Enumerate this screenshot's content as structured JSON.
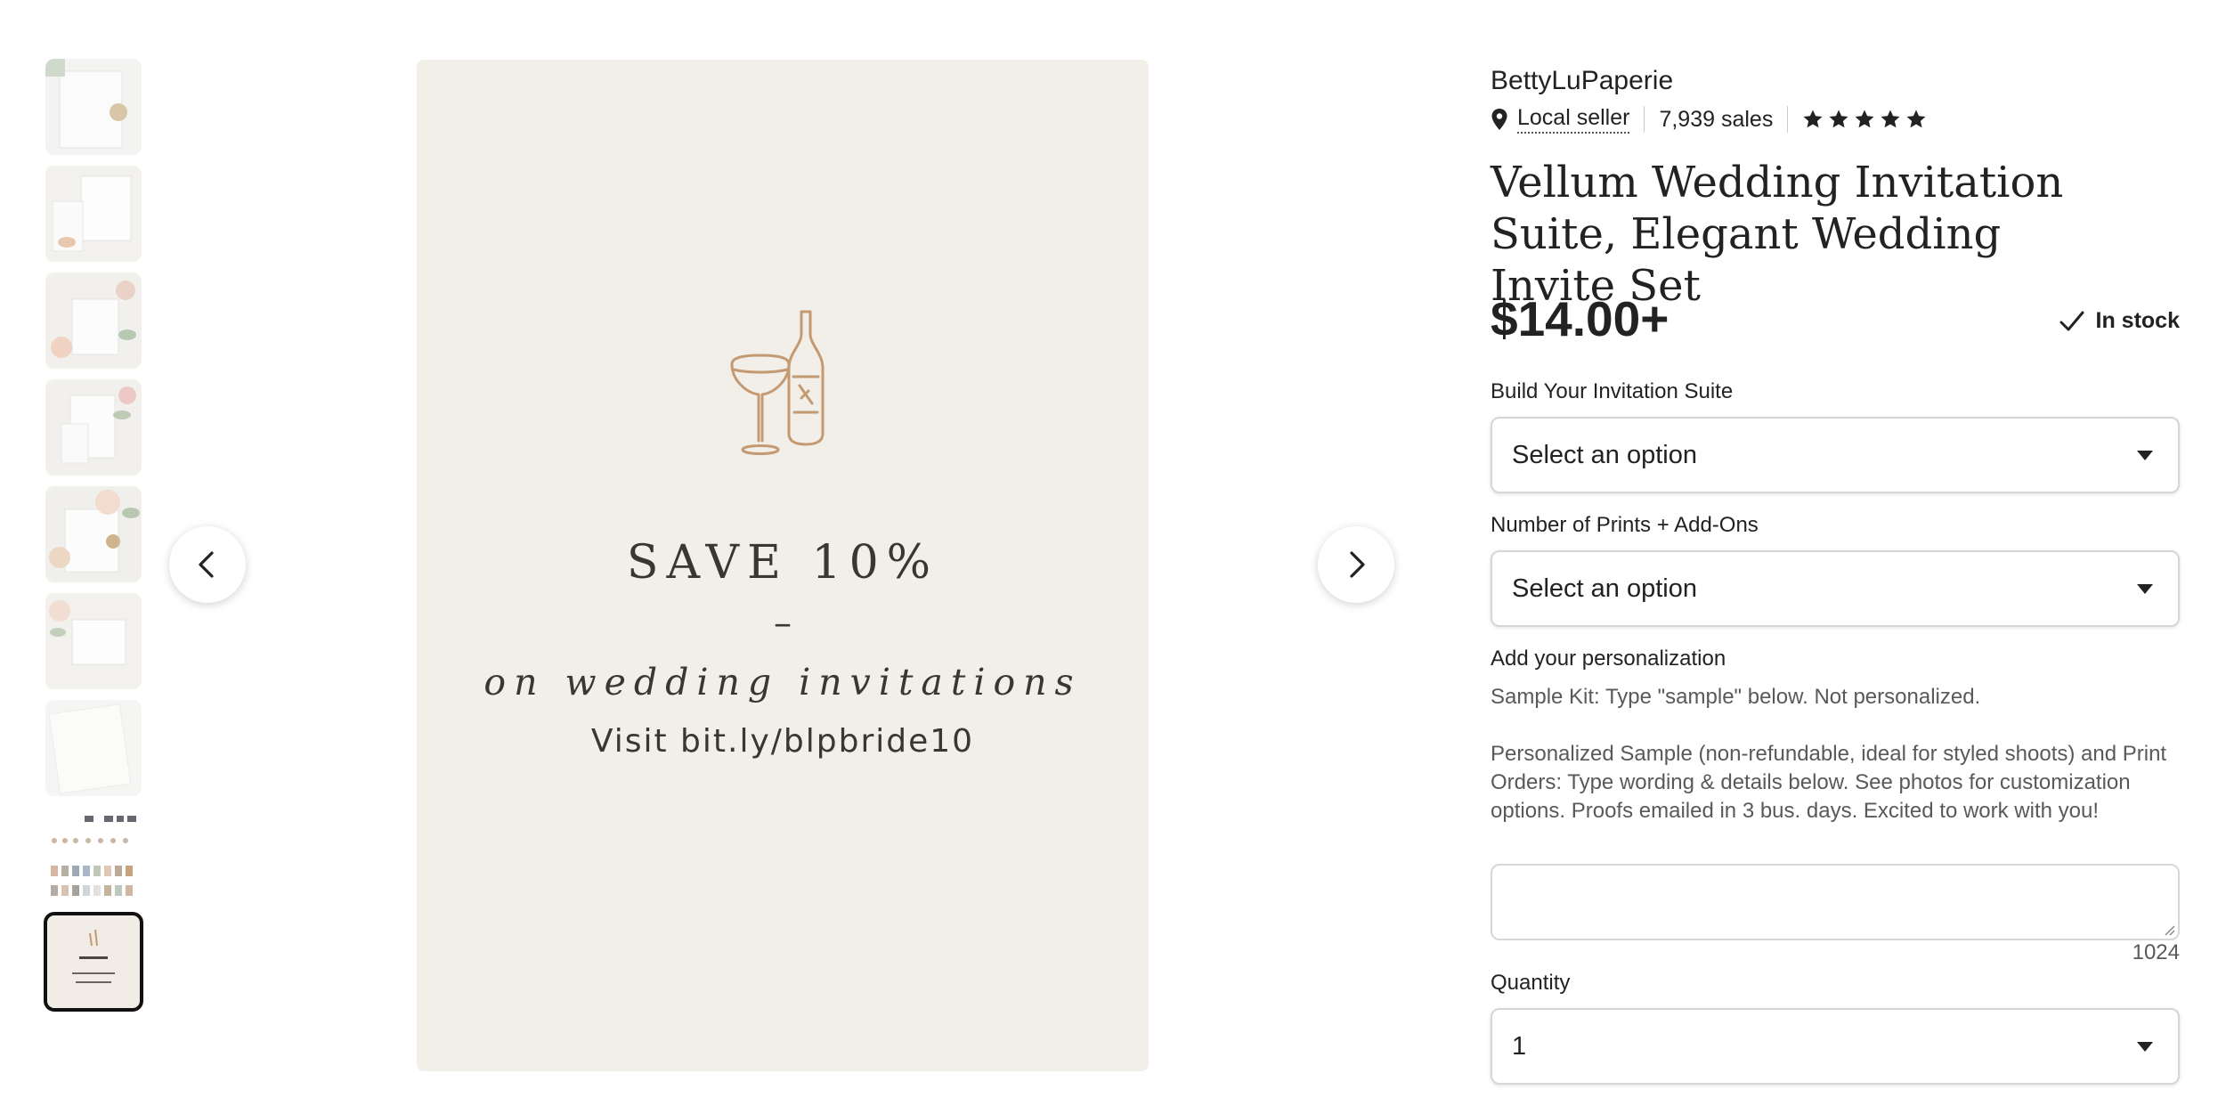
{
  "gallery": {
    "thumbnails": [
      {
        "name": "thumb-1"
      },
      {
        "name": "thumb-2"
      },
      {
        "name": "thumb-3"
      },
      {
        "name": "thumb-4"
      },
      {
        "name": "thumb-5"
      },
      {
        "name": "thumb-6"
      },
      {
        "name": "thumb-7"
      },
      {
        "name": "thumb-8"
      },
      {
        "name": "thumb-9",
        "active": true
      }
    ],
    "promo": {
      "headline": "SAVE 10%",
      "dash": "–",
      "subline": "on wedding invitations",
      "url": "Visit bit.ly/blpbride10"
    },
    "icons": {
      "prev": "chevron-left-icon",
      "next": "chevron-right-icon"
    }
  },
  "listing": {
    "shop_name": "BettyLuPaperie",
    "local_seller": "Local seller",
    "sales": "7,939 sales",
    "rating_stars": 5,
    "title": "Vellum Wedding Invitation Suite, Elegant Wedding Invite Set",
    "price": "$14.00+",
    "stock": "In stock",
    "options": [
      {
        "label": "Build Your Invitation Suite",
        "value": "Select an option"
      },
      {
        "label": "Number of Prints + Add-Ons",
        "value": "Select an option"
      }
    ],
    "personalization": {
      "label": "Add your personalization",
      "help_1": "Sample Kit: Type \"sample\" below. Not personalized.",
      "help_2": "Personalized Sample (non-refundable, ideal for styled shoots) and Print Orders: Type wording & details below. See photos for customization options. Proofs emailed in 3 bus. days. Excited to work with you!",
      "counter": "1024"
    },
    "quantity": {
      "label": "Quantity",
      "value": "1"
    }
  },
  "colors": {
    "accent": "#222222",
    "promo_bg": "#f2efe9",
    "illustration": "#c49a72"
  }
}
